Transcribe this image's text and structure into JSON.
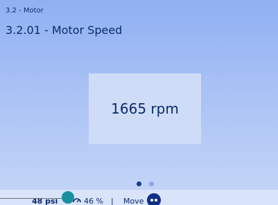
{
  "header": {
    "breadcrumb": "3.2 - Motor",
    "title": "3.2.01 - Motor Speed"
  },
  "main": {
    "value_display": "1665 rpm",
    "page_indicator": {
      "pages": 2,
      "active": 1
    }
  },
  "status_bar": {
    "pressure": "48 psi",
    "load": "46 %",
    "separator": "|",
    "move_label": "Move",
    "icons": [
      "load-gauge-icon",
      "move-icon"
    ]
  },
  "colors": {
    "accent": "#0b2a6b",
    "screen_top": "#8fb0f2",
    "screen_bottom": "#c7d6f7",
    "value_box": "#cfdcf8",
    "handle": "#1a8fa0"
  }
}
